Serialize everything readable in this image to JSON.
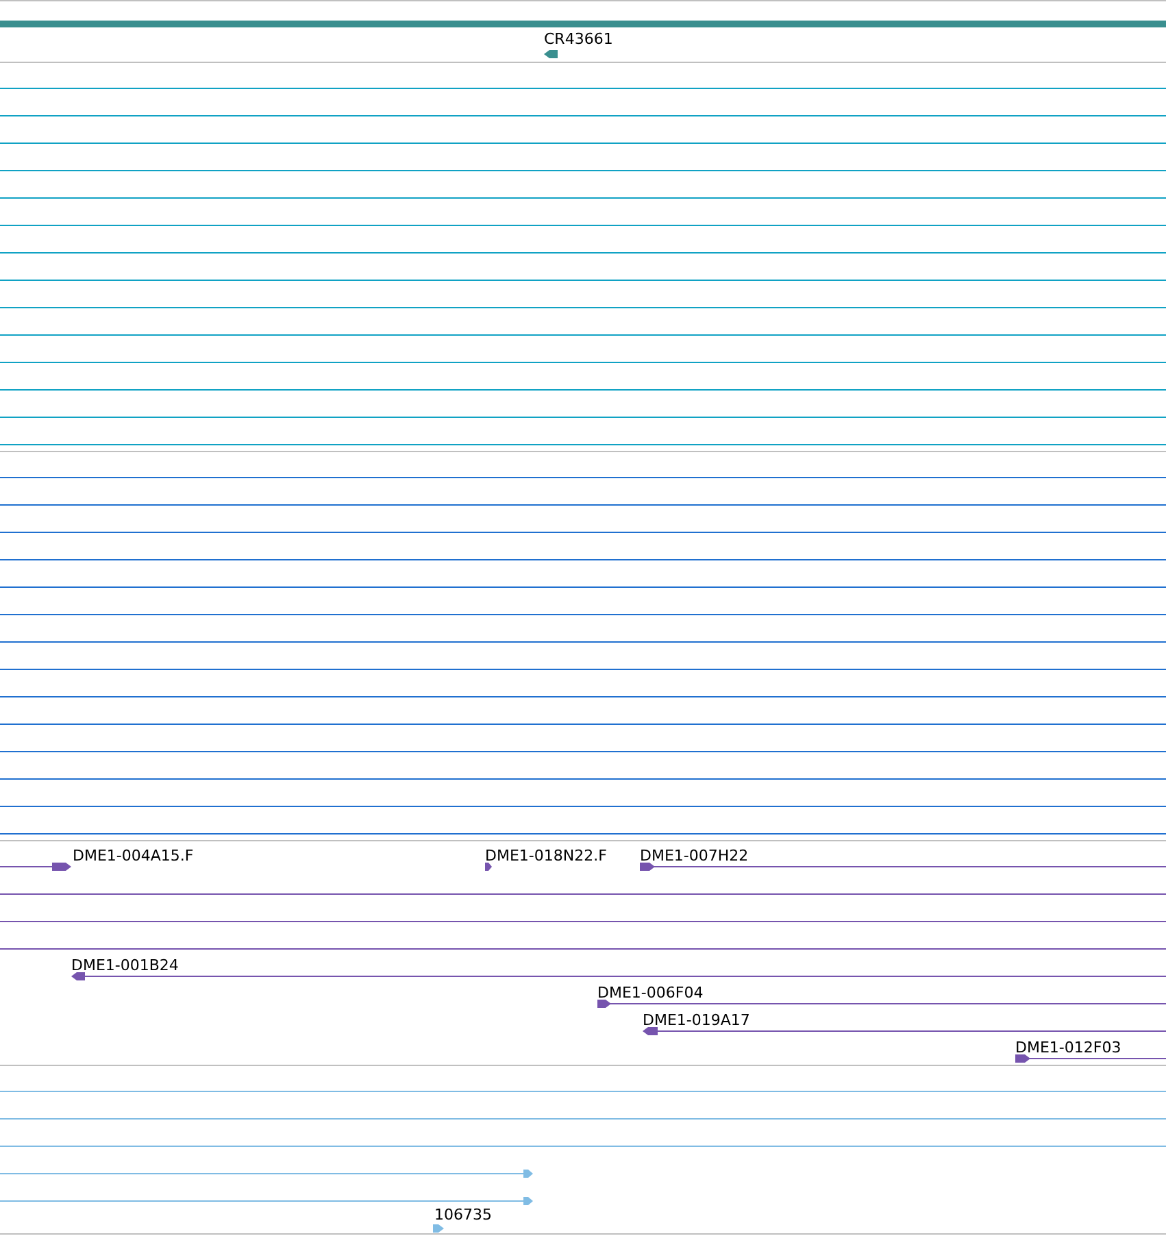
{
  "tracks": [
    {
      "kind": "gene",
      "color": "#3a8f8f",
      "features": [
        {
          "label": "CR43661",
          "reverse": true
        }
      ]
    },
    {
      "kind": "lines",
      "color": "#10a2c4"
    },
    {
      "kind": "lines",
      "color": "#2070d0"
    },
    {
      "kind": "clones",
      "color": "#7654ae",
      "features": [
        {
          "label": "DME1-004A15.F",
          "reverse": false
        },
        {
          "label": "DME1-018N22.F",
          "reverse": false
        },
        {
          "label": "DME1-007H22",
          "reverse": false
        },
        {
          "label": "DME1-001B24",
          "reverse": true
        },
        {
          "label": "DME1-006F04",
          "reverse": false
        },
        {
          "label": "DME1-019A17",
          "reverse": true
        },
        {
          "label": "DME1-012F03",
          "reverse": false
        }
      ]
    },
    {
      "kind": "reads",
      "color": "#80bce4",
      "features": [
        {
          "label": "106735",
          "reverse": false
        }
      ]
    }
  ]
}
